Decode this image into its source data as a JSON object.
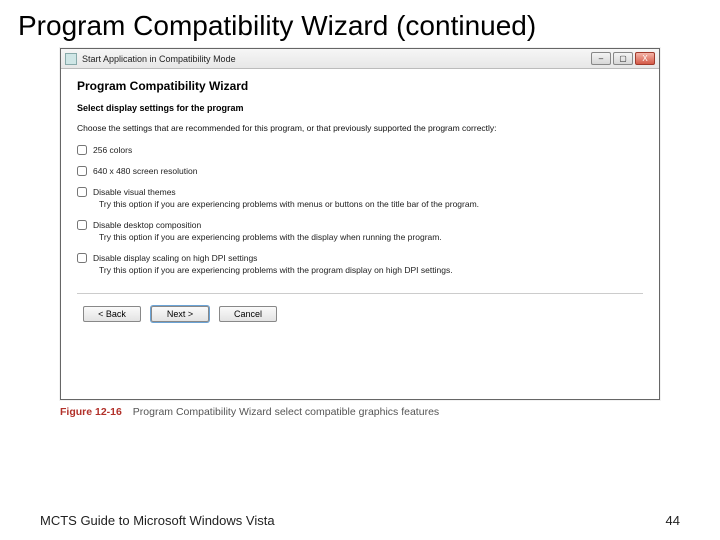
{
  "slide": {
    "title": "Program Compatibility Wizard (continued)",
    "footer_left": "MCTS Guide to Microsoft Windows Vista",
    "page_number": "44"
  },
  "window": {
    "title": "Start Application in Compatibility Mode",
    "controls": {
      "min": "–",
      "max": "▢",
      "close": "X"
    }
  },
  "wizard": {
    "heading": "Program Compatibility Wizard",
    "subhead": "Select display settings for the program",
    "instruction": "Choose the settings that are recommended for this program, or that previously supported the program correctly:",
    "options": [
      {
        "label": "256 colors",
        "hint": ""
      },
      {
        "label": "640 x 480 screen resolution",
        "hint": ""
      },
      {
        "label": "Disable visual themes",
        "hint": "Try this option if you are experiencing problems with menus or buttons on the title bar of the program."
      },
      {
        "label": "Disable desktop composition",
        "hint": "Try this option if you are experiencing problems with the display when running the program."
      },
      {
        "label": "Disable display scaling on high DPI settings",
        "hint": "Try this option if you are experiencing problems with the program display on high DPI settings."
      }
    ],
    "buttons": {
      "back": "< Back",
      "next": "Next >",
      "cancel": "Cancel"
    }
  },
  "figure": {
    "label": "Figure 12-16",
    "caption": "Program Compatibility Wizard select compatible graphics features"
  }
}
